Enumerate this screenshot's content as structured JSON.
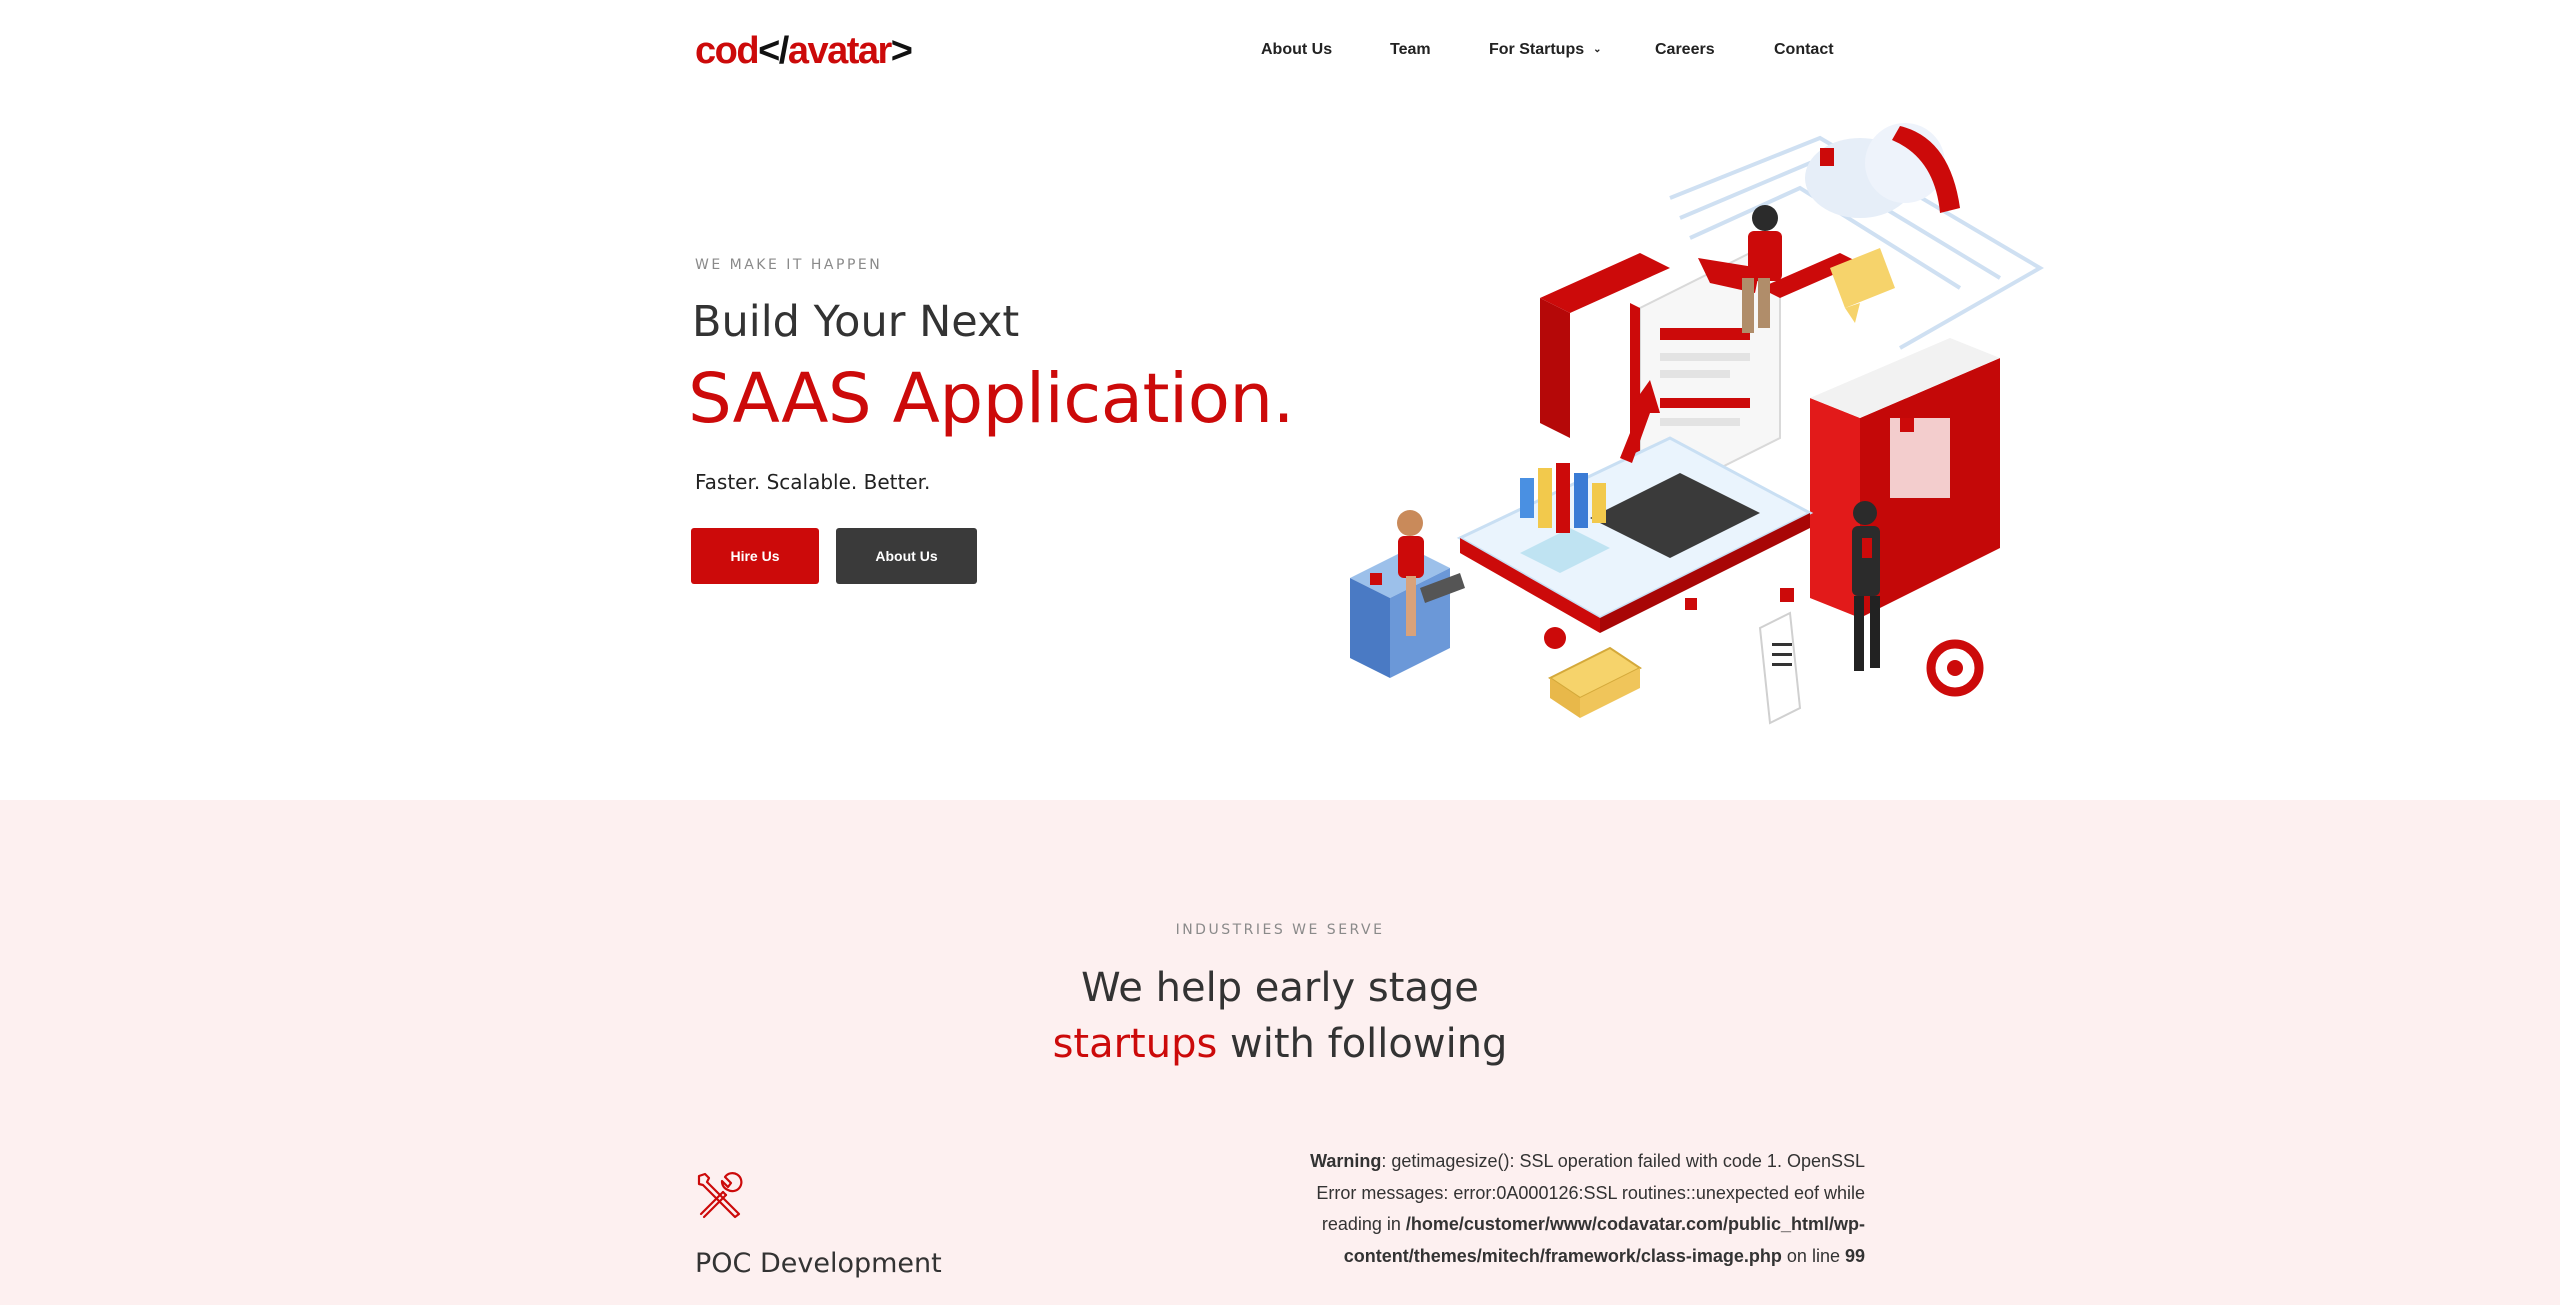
{
  "header": {
    "logo": {
      "part1": "cod",
      "part2": "</",
      "part3": "avatar",
      "part4": ">"
    },
    "nav": [
      {
        "label": "About Us"
      },
      {
        "label": "Team"
      },
      {
        "label": "For Startups",
        "has_dropdown": true
      },
      {
        "label": "Careers"
      },
      {
        "label": "Contact"
      }
    ]
  },
  "hero": {
    "eyebrow": "WE MAKE IT HAPPEN",
    "line1": "Build Your Next",
    "line2": "SAAS Application.",
    "tagline": "Faster. Scalable. Better.",
    "buttons": {
      "hire": "Hire Us",
      "about": "About Us"
    }
  },
  "industries": {
    "eyebrow": "INDUSTRIES WE SERVE",
    "title_line1": "We help early stage",
    "title_accent": "startups",
    "title_rest": " with following",
    "poc_title": "POC Development"
  },
  "warning": {
    "label": "Warning",
    "text1": ": getimagesize(): SSL operation failed with code 1. OpenSSL Error messages: error:0A000126:SSL routines::unexpected eof while reading in ",
    "path": "/home/customer/www/codavatar.com/public_html/wp-content/themes/mitech/framework/class-image.php",
    "text2": " on line ",
    "line": "99"
  },
  "colors": {
    "brand_red": "#cc0a0a",
    "dark_button": "#3a3a3a",
    "section_bg": "#fdf0f0"
  },
  "icons": {
    "dropdown": "chevron-down-icon",
    "poc": "tools-icon"
  }
}
